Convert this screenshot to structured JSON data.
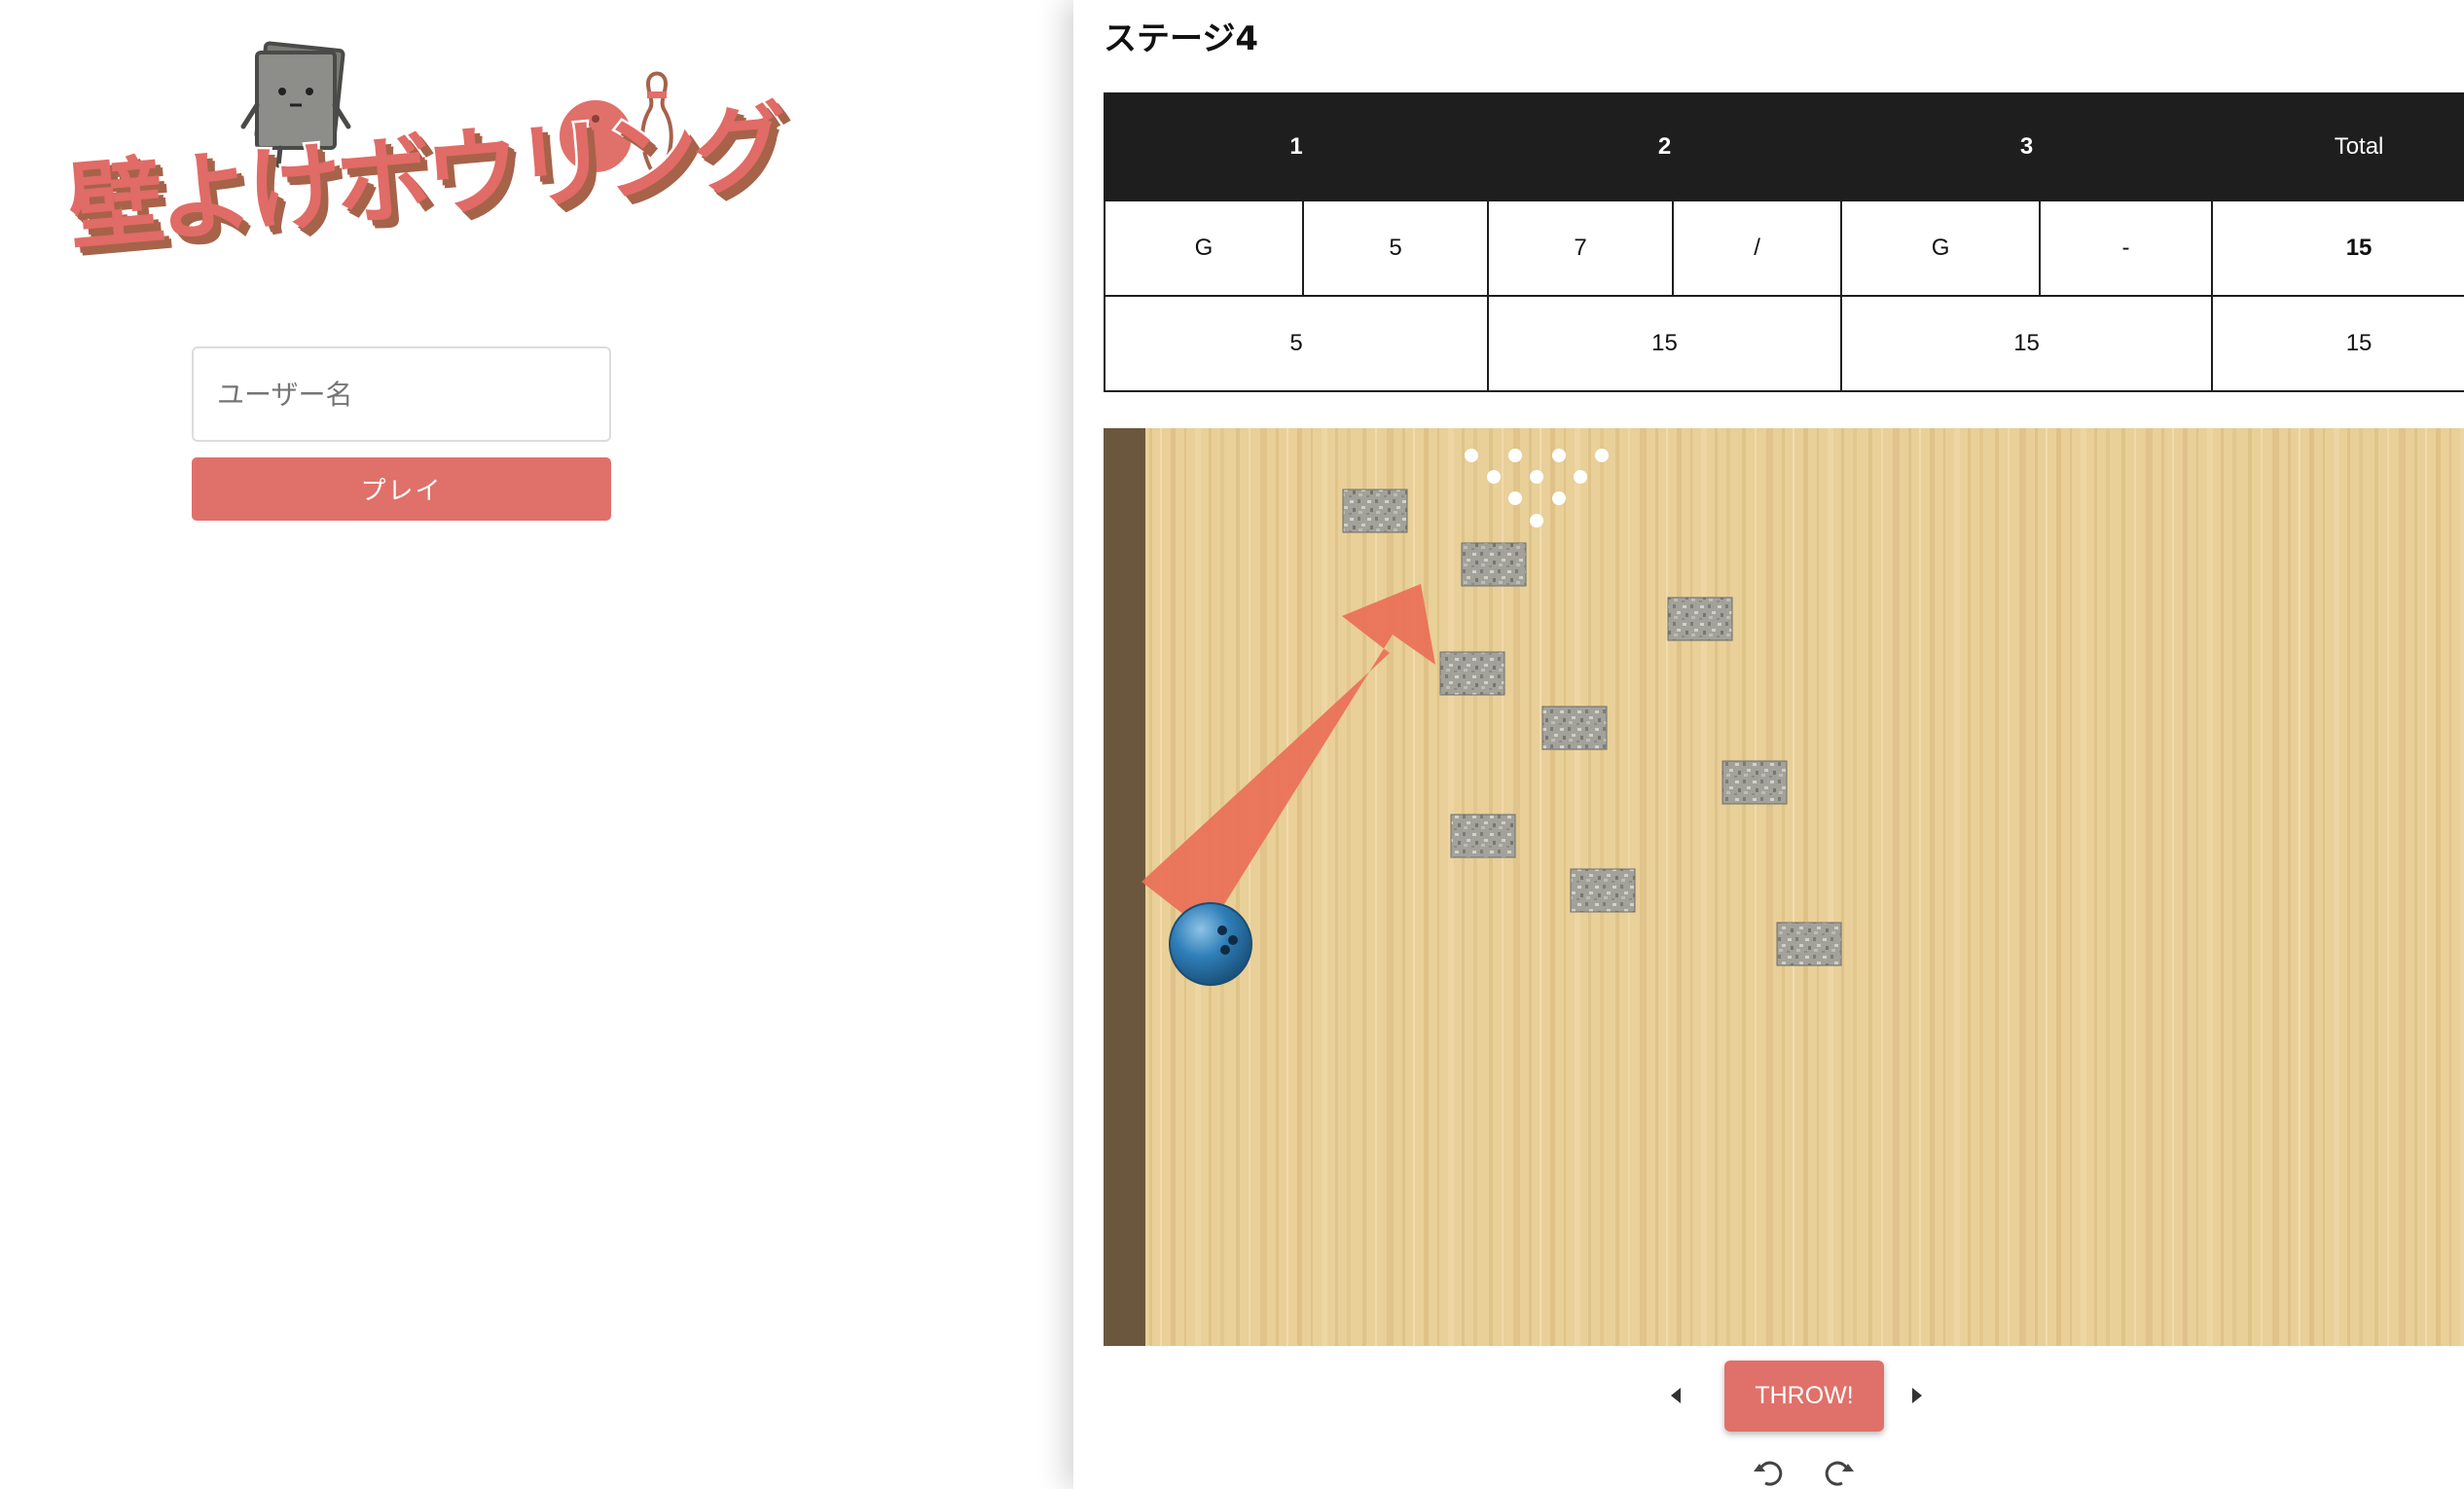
{
  "login": {
    "logo_title": "壁よけボウリング",
    "username_placeholder": "ユーザー名",
    "play_label": "プレイ",
    "accent_color": "#e0706a"
  },
  "game": {
    "stage_title": "ステージ4",
    "scoreboard": {
      "headers": [
        "1",
        "2",
        "3",
        "Total"
      ],
      "throws": [
        "G",
        "5",
        "7",
        "/",
        "G",
        "-"
      ],
      "throws_total": "15",
      "cumulative": [
        "5",
        "15",
        "15",
        "15"
      ]
    },
    "throw_label": "THROW!",
    "controls": [
      "arrow-left-icon",
      "arrow-right-icon",
      "rotate-left-icon",
      "rotate-right-icon"
    ],
    "colors": {
      "lane": "#e9cf98",
      "gutter": "#6b573d",
      "aim_arrow": "#ea6d55",
      "ball": "#2f7fb8",
      "wall_block": "#9a9a93",
      "pin": "#ffffff"
    }
  }
}
